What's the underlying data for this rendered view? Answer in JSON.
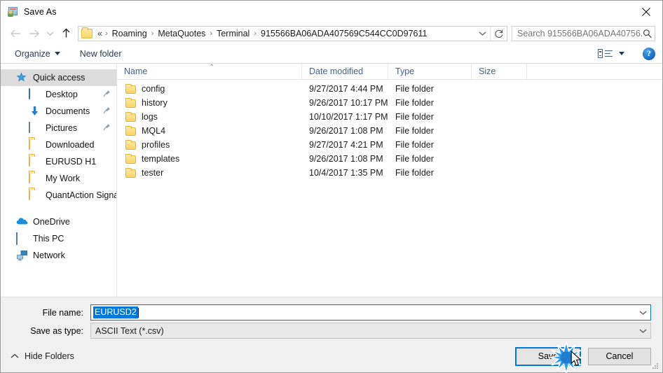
{
  "window": {
    "title": "Save As",
    "icon": "save-as-app-icon",
    "close_label": "✕"
  },
  "nav": {
    "back_icon": "arrow-left-icon",
    "forward_icon": "arrow-right-icon",
    "recent_icon": "chevron-down-icon",
    "up_icon": "arrow-up-icon",
    "breadcrumb_prefix": "«",
    "breadcrumbs": [
      "Roaming",
      "MetaQuotes",
      "Terminal",
      "915566BA06ADA407569C544CC0D97611"
    ],
    "separator": "›",
    "dropdown_icon": "chevron-down-icon",
    "refresh_icon": "refresh-icon"
  },
  "search": {
    "placeholder": "Search 915566BA06ADA40756...",
    "icon": "search-icon"
  },
  "toolbar": {
    "organize_label": "Organize",
    "new_folder_label": "New folder",
    "view_icon": "view-layout-icon",
    "view_caret_icon": "chevron-down-icon",
    "help_label": "?"
  },
  "sidebar": {
    "items": [
      {
        "label": "Quick access",
        "icon": "star-pin-icon",
        "selected": true,
        "pinned": false,
        "level": 1
      },
      {
        "label": "Desktop",
        "icon": "desktop-icon",
        "selected": false,
        "pinned": true,
        "level": 2
      },
      {
        "label": "Documents",
        "icon": "documents-icon",
        "selected": false,
        "pinned": true,
        "level": 2
      },
      {
        "label": "Pictures",
        "icon": "pictures-icon",
        "selected": false,
        "pinned": true,
        "level": 2
      },
      {
        "label": "Downloaded",
        "icon": "folder-icon",
        "selected": false,
        "pinned": false,
        "level": 2
      },
      {
        "label": "EURUSD H1",
        "icon": "folder-icon",
        "selected": false,
        "pinned": false,
        "level": 2
      },
      {
        "label": "My Work",
        "icon": "folder-icon",
        "selected": false,
        "pinned": false,
        "level": 2
      },
      {
        "label": "QuantAction Signal",
        "icon": "folder-icon",
        "selected": false,
        "pinned": false,
        "level": 2
      },
      {
        "label": "OneDrive",
        "icon": "onedrive-cloud-icon",
        "selected": false,
        "pinned": false,
        "level": 1
      },
      {
        "label": "This PC",
        "icon": "this-pc-icon",
        "selected": false,
        "pinned": false,
        "level": 1
      },
      {
        "label": "Network",
        "icon": "network-icon",
        "selected": false,
        "pinned": false,
        "level": 1
      }
    ]
  },
  "filelist": {
    "columns": [
      "Name",
      "Date modified",
      "Type",
      "Size"
    ],
    "sort_indicator": "⌃",
    "rows": [
      {
        "name": "config",
        "date": "9/27/2017 4:44 PM",
        "type": "File folder",
        "size": ""
      },
      {
        "name": "history",
        "date": "9/26/2017 10:17 PM",
        "type": "File folder",
        "size": ""
      },
      {
        "name": "logs",
        "date": "10/10/2017 1:17 PM",
        "type": "File folder",
        "size": ""
      },
      {
        "name": "MQL4",
        "date": "9/26/2017 1:08 PM",
        "type": "File folder",
        "size": ""
      },
      {
        "name": "profiles",
        "date": "9/27/2017 4:21 PM",
        "type": "File folder",
        "size": ""
      },
      {
        "name": "templates",
        "date": "9/26/2017 1:08 PM",
        "type": "File folder",
        "size": ""
      },
      {
        "name": "tester",
        "date": "10/4/2017 1:35 PM",
        "type": "File folder",
        "size": ""
      }
    ]
  },
  "form": {
    "filename_label": "File name:",
    "filename_value": "EURUSD2",
    "filetype_label": "Save as type:",
    "filetype_value": "ASCII Text (*.csv)",
    "dropdown_icon": "chevron-down-icon"
  },
  "footer": {
    "hide_folders_label": "Hide Folders",
    "hide_folders_icon": "chevron-up-icon",
    "save_label": "Save",
    "cancel_label": "Cancel",
    "resize_grip_icon": "resize-grip-icon"
  },
  "overlay": {
    "click_burst_icon": "click-burst-icon",
    "cursor_icon": "mouse-cursor-icon"
  },
  "colors": {
    "accent": "#0078d7",
    "folder_yellow": "#fbd463",
    "header_text": "#45618b",
    "chrome_bg": "#f0f0f0"
  }
}
